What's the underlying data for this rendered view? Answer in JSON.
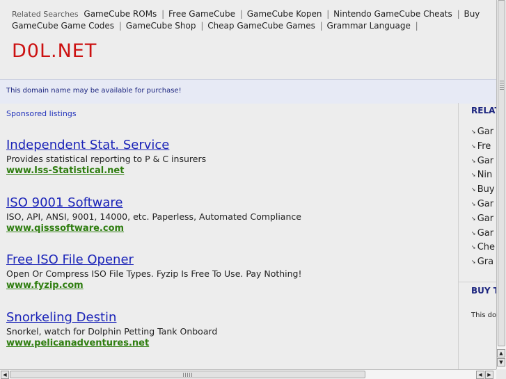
{
  "related_bar": {
    "label": "Related Searches",
    "links": [
      "GameCube ROMs",
      "Free GameCube",
      "GameCube Kopen",
      "Nintendo GameCube Cheats",
      "Buy GameCube Game",
      "Codes",
      "GameCube Shop",
      "Cheap GameCube Games",
      "Grammar Language"
    ],
    "separator": "|"
  },
  "site_title": "D0L.NET",
  "notice": "This domain name may be available for purchase!",
  "main": {
    "sponsored_label": "Sponsored listings",
    "listings": [
      {
        "title": "Independent Stat. Service",
        "description": "Provides statistical reporting to P & C insurers",
        "url": "www.Iss-Statistical.net"
      },
      {
        "title": "ISO 9001 Software",
        "description": "ISO, API, ANSI, 9001, 14000, etc. Paperless, Automated Compliance",
        "url": "www.qisssoftware.com"
      },
      {
        "title": "Free ISO File Opener",
        "description": "Open Or Compress ISO File Types. Fyzip Is Free To Use. Pay Nothing!",
        "url": "www.fyzip.com"
      },
      {
        "title": "Snorkeling Destin",
        "description": "Snorkel, watch for Dolphin Petting Tank Onboard",
        "url": "www.pelicanadventures.net"
      }
    ]
  },
  "right_column": {
    "related_heading": "RELAT",
    "items": [
      "Gar",
      "Fre",
      "Gar",
      "Nin",
      "Buy",
      "Gar",
      "Gar",
      "Gar",
      "Che",
      "Gra"
    ],
    "buy_heading": "BUY T",
    "buy_note": "This dor"
  },
  "scrollbars": {
    "up_glyph": "▲",
    "down_glyph": "▼",
    "left_glyph": "◀",
    "right_glyph": "▶"
  },
  "colors": {
    "title_red": "#cc1111",
    "link_blue": "#1a23b8",
    "url_green": "#2e7d0f",
    "notice_bg": "#e7eaf5"
  }
}
